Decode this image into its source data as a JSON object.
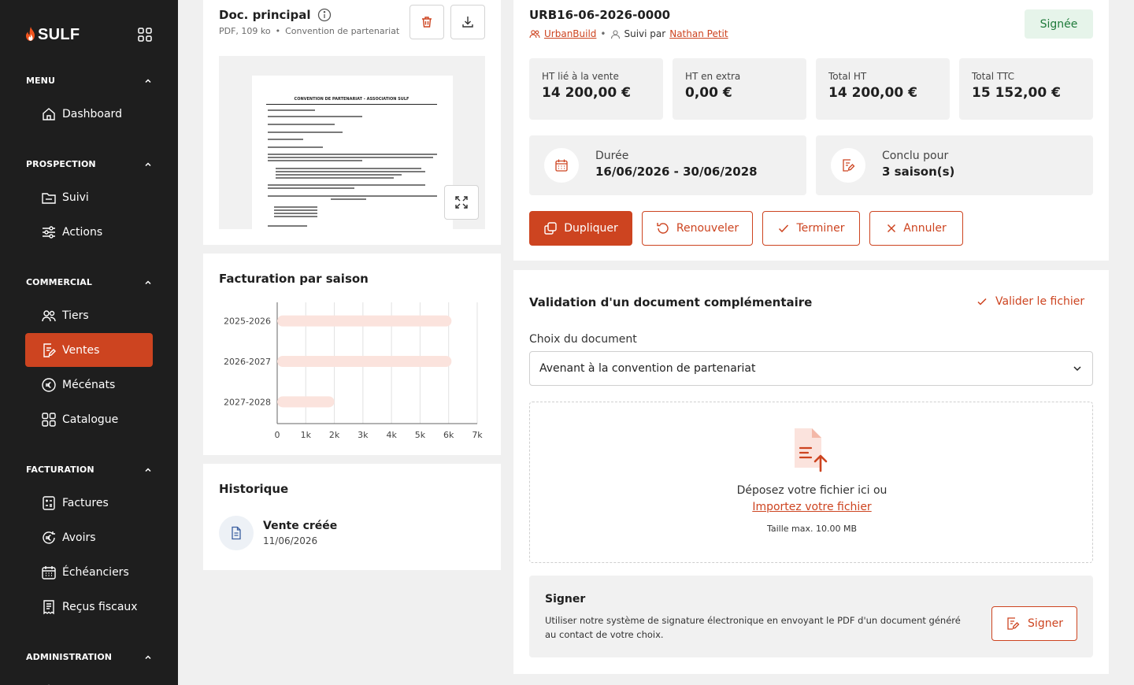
{
  "brand": {
    "name": "SULF"
  },
  "sidebar": {
    "sections": [
      {
        "title": "MENU",
        "items": [
          {
            "label": "Dashboard"
          }
        ]
      },
      {
        "title": "PROSPECTION",
        "items": [
          {
            "label": "Suivi"
          },
          {
            "label": "Actions"
          }
        ]
      },
      {
        "title": "COMMERCIAL",
        "items": [
          {
            "label": "Tiers"
          },
          {
            "label": "Ventes"
          },
          {
            "label": "Mécénats"
          },
          {
            "label": "Catalogue"
          }
        ]
      },
      {
        "title": "FACTURATION",
        "items": [
          {
            "label": "Factures"
          },
          {
            "label": "Avoirs"
          },
          {
            "label": "Échéanciers"
          },
          {
            "label": "Reçus fiscaux"
          }
        ]
      },
      {
        "title": "ADMINISTRATION",
        "items": []
      }
    ],
    "active_item": "Ventes"
  },
  "doc": {
    "title": "Doc. principal",
    "meta_type": "PDF, 109 ko",
    "meta_sep": "•",
    "meta_name": "Convention de partenariat",
    "preview_heading": "CONVENTION DE PARTENARIAT - ASSOCIATION SULF"
  },
  "chart_card": {
    "title": "Facturation par saison"
  },
  "chart_data": {
    "type": "bar",
    "orientation": "horizontal",
    "categories": [
      "2025-2026",
      "2026-2027",
      "2027-2028"
    ],
    "values": [
      6100,
      6100,
      2000
    ],
    "xlim": [
      0,
      7000
    ],
    "xticks": [
      "0",
      "1k",
      "2k",
      "3k",
      "4k",
      "5k",
      "6k",
      "7k"
    ],
    "grid": true,
    "bar_color": "#fbe3dd"
  },
  "history": {
    "title": "Historique",
    "items": [
      {
        "title": "Vente créée",
        "date": "11/06/2026"
      }
    ]
  },
  "sale": {
    "reference": "URB16-06-2026-0000",
    "client": "UrbanBuild",
    "sep": "•",
    "followed_prefix": "Suivi par",
    "followed_by": "Nathan Petit",
    "status": "Signée",
    "status_bg": "#e6f4ea",
    "status_color": "#1e7a3a",
    "kpis": [
      {
        "label": "HT lié à la vente",
        "value": "14 200,00 €"
      },
      {
        "label": "HT en extra",
        "value": "0,00 €"
      },
      {
        "label": "Total HT",
        "value": "14 200,00 €"
      },
      {
        "label": "Total TTC",
        "value": "15 152,00 €"
      }
    ],
    "duration": {
      "label": "Durée",
      "value": "16/06/2026 - 30/06/2028"
    },
    "seasons": {
      "label": "Conclu pour",
      "value": "3 saison(s)"
    },
    "actions": {
      "duplicate": "Dupliquer",
      "renew": "Renouveler",
      "finish": "Terminer",
      "cancel": "Annuler"
    }
  },
  "validation": {
    "title": "Validation d'un document complémentaire",
    "validate_label": "Valider le fichier",
    "choice_label": "Choix du document",
    "selected": "Avenant à la convention de partenariat",
    "drop_text": "Déposez votre fichier ici ou",
    "import_link": "Importez votre fichier",
    "max_size": "Taille max. 10.00 MB"
  },
  "sign": {
    "title": "Signer",
    "description": "Utiliser notre système de signature électronique en envoyant le PDF d'un document généré au contact de votre choix.",
    "button": "Signer"
  },
  "colors": {
    "accent": "#cd4420",
    "sidebar_bg": "#1e1e1e",
    "panel_bg": "#f1f1f1"
  }
}
